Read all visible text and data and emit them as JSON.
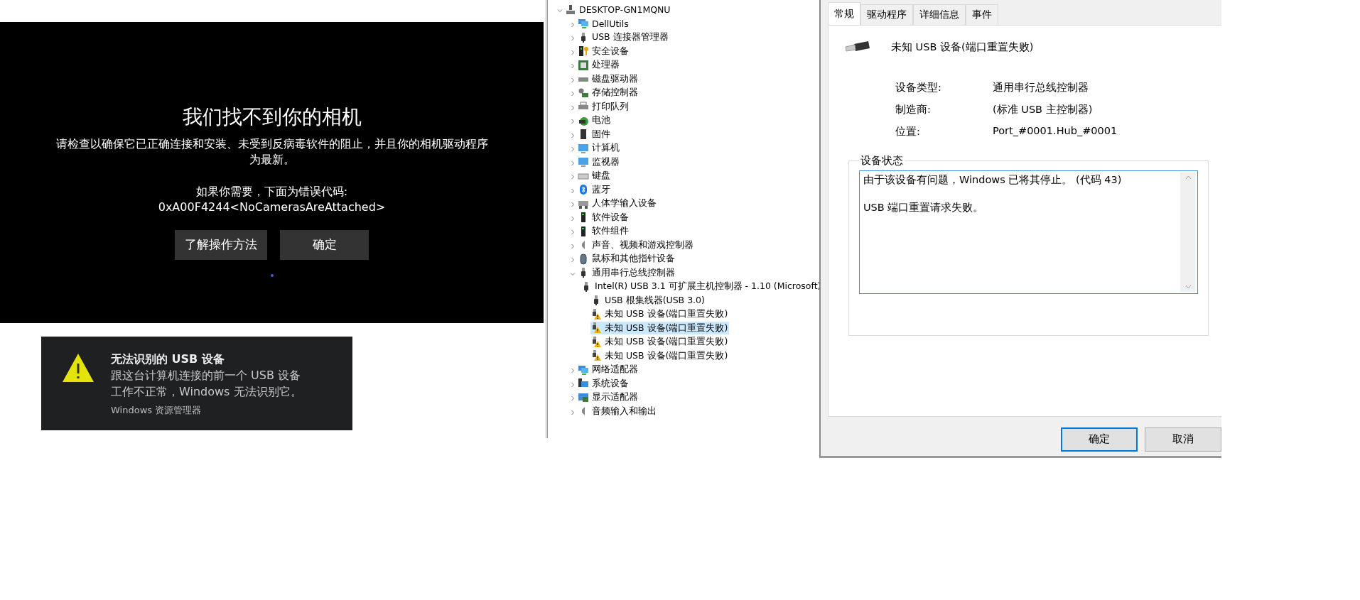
{
  "camera_error": {
    "title": "我们找不到你的相机",
    "message": "请检查以确保它已正确连接和安装、未受到反病毒软件的阻止，并且你的相机驱动程序为最新。",
    "error_label": "如果你需要，下面为错误代码:",
    "error_code": "0xA00F4244<NoCamerasAreAttached>",
    "buttons": [
      {
        "label": "了解操作方法"
      },
      {
        "label": "确定"
      }
    ]
  },
  "notification": {
    "title": "无法识别的 USB 设备",
    "message_lines": [
      "跟这台计算机连接的前一个 USB 设备",
      "工作不正常，Windows 无法识别它。"
    ],
    "source": "Windows 资源管理器"
  },
  "device_tree": [
    {
      "label": "DESKTOP-GN1MQNU",
      "kind": "computer",
      "expanded": true,
      "selected": false,
      "children": [
        {
          "label": "DellUtils",
          "kind": "network",
          "expanded": false,
          "selected": false
        },
        {
          "label": "USB 连接器管理器",
          "kind": "usb",
          "expanded": false,
          "selected": false
        },
        {
          "label": "安全设备",
          "kind": "security",
          "expanded": false,
          "selected": false
        },
        {
          "label": "处理器",
          "kind": "chip",
          "expanded": false,
          "selected": false
        },
        {
          "label": "磁盘驱动器",
          "kind": "disk",
          "expanded": false,
          "selected": false
        },
        {
          "label": "存储控制器",
          "kind": "storage",
          "expanded": false,
          "selected": false
        },
        {
          "label": "打印队列",
          "kind": "printer",
          "expanded": false,
          "selected": false
        },
        {
          "label": "电池",
          "kind": "battery",
          "expanded": false,
          "selected": false
        },
        {
          "label": "固件",
          "kind": "firmware",
          "expanded": false,
          "selected": false
        },
        {
          "label": "计算机",
          "kind": "monitor",
          "expanded": false,
          "selected": false
        },
        {
          "label": "监视器",
          "kind": "monitor",
          "expanded": false,
          "selected": false
        },
        {
          "label": "键盘",
          "kind": "keyboard",
          "expanded": false,
          "selected": false
        },
        {
          "label": "蓝牙",
          "kind": "bluetooth",
          "expanded": false,
          "selected": false
        },
        {
          "label": "人体学输入设备",
          "kind": "hid",
          "expanded": false,
          "selected": false
        },
        {
          "label": "软件设备",
          "kind": "device",
          "expanded": false,
          "selected": false
        },
        {
          "label": "软件组件",
          "kind": "device",
          "expanded": false,
          "selected": false
        },
        {
          "label": "声音、视频和游戏控制器",
          "kind": "speaker",
          "expanded": false,
          "selected": false
        },
        {
          "label": "鼠标和其他指针设备",
          "kind": "mouse",
          "expanded": false,
          "selected": false
        },
        {
          "label": "通用串行总线控制器",
          "kind": "usb",
          "expanded": true,
          "selected": false,
          "children": [
            {
              "label": "Intel(R) USB 3.1 可扩展主机控制器 - 1.10 (Microsoft)",
              "kind": "usb",
              "selected": false
            },
            {
              "label": "USB 根集线器(USB 3.0)",
              "kind": "usb",
              "selected": false
            },
            {
              "label": "未知 USB 设备(端口重置失败)",
              "kind": "usb-warning",
              "selected": false
            },
            {
              "label": "未知 USB 设备(端口重置失败)",
              "kind": "usb-warning",
              "selected": true
            },
            {
              "label": "未知 USB 设备(端口重置失败)",
              "kind": "usb-warning",
              "selected": false
            },
            {
              "label": "未知 USB 设备(端口重置失败)",
              "kind": "usb-warning",
              "selected": false
            }
          ]
        },
        {
          "label": "网络适配器",
          "kind": "network",
          "expanded": false,
          "selected": false
        },
        {
          "label": "系统设备",
          "kind": "system",
          "expanded": false,
          "selected": false
        },
        {
          "label": "显示适配器",
          "kind": "display",
          "expanded": false,
          "selected": false
        },
        {
          "label": "音频输入和输出",
          "kind": "speaker",
          "expanded": false,
          "selected": false
        }
      ]
    }
  ],
  "properties_dialog": {
    "tabs": [
      {
        "label": "常规",
        "selected": true
      },
      {
        "label": "驱动程序",
        "selected": false
      },
      {
        "label": "详细信息",
        "selected": false
      },
      {
        "label": "事件",
        "selected": false
      }
    ],
    "device_name": "未知 USB 设备(端口重置失败)",
    "properties": [
      {
        "label": "设备类型:",
        "value": "通用串行总线控制器"
      },
      {
        "label": "制造商:",
        "value": "(标准 USB 主控制器)"
      },
      {
        "label": "位置:",
        "value": "Port_#0001.Hub_#0001"
      }
    ],
    "status_group": "设备状态",
    "status_text": "由于该设备有问题，Windows 已将其停止。 (代码 43)\n\nUSB 端口重置请求失败。",
    "buttons": [
      {
        "label": "确定",
        "default": true
      },
      {
        "label": "取消",
        "default": false
      }
    ]
  }
}
